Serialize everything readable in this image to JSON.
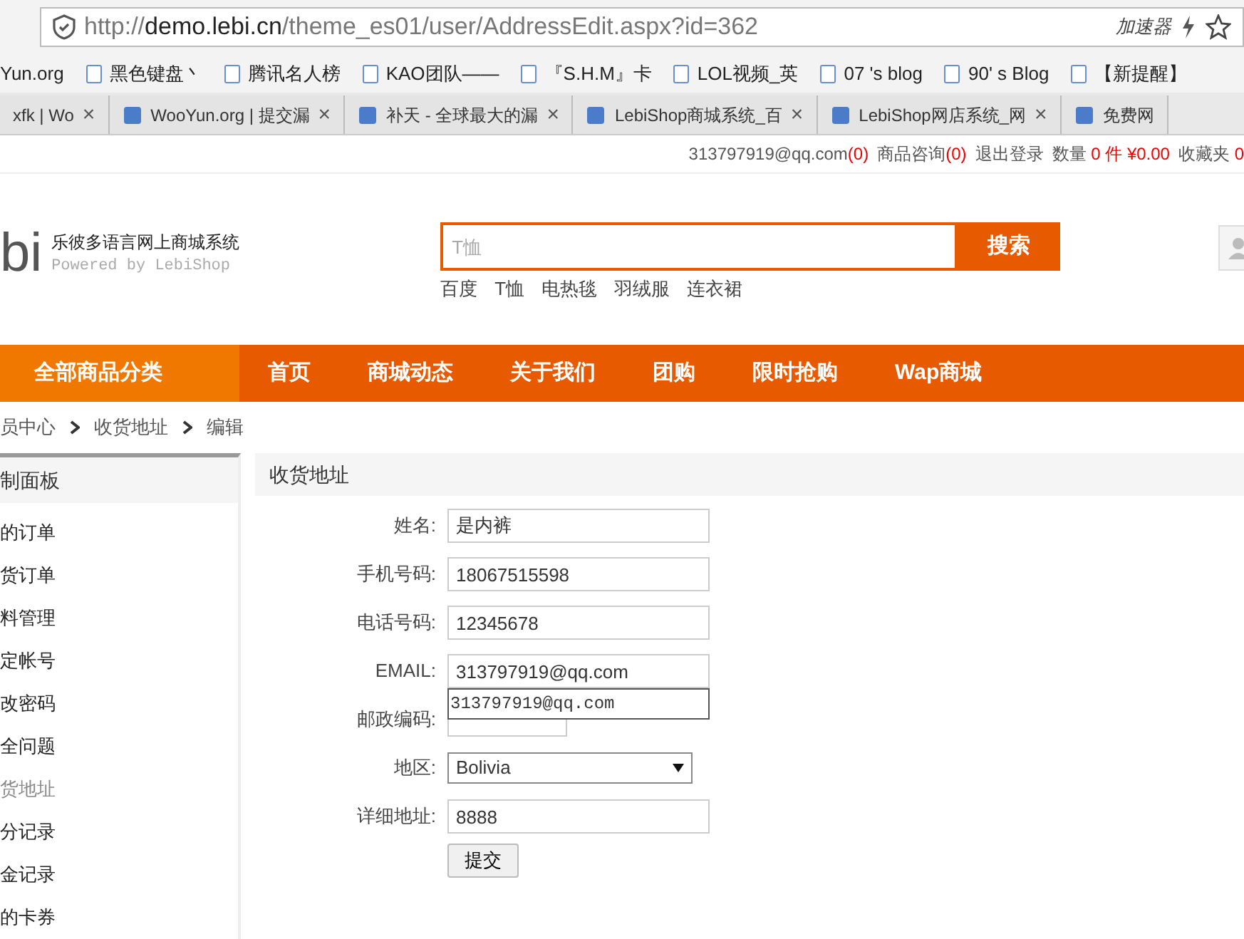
{
  "browser": {
    "url_prefix": "http://",
    "url_host": "demo.lebi.cn",
    "url_path": "/theme_es01/user/AddressEdit.aspx?id=362",
    "accelerator": "加速器",
    "bookmarks": [
      "Yun.org",
      "黑色键盘丶",
      "腾讯名人榜",
      "KAO团队——",
      "『S.H.M』卡",
      "LOL视频_英",
      "07 's blog",
      "90' s Blog",
      "【新提醒】"
    ],
    "tabs": [
      {
        "label": "xfk | Wo",
        "close": "×",
        "selected": false
      },
      {
        "label": "WooYun.org | 提交漏",
        "close": "×",
        "selected": false
      },
      {
        "label": "补天 - 全球最大的漏",
        "close": "×",
        "selected": false
      },
      {
        "label": "LebiShop商城系统_百",
        "close": "×",
        "selected": false
      },
      {
        "label": "LebiShop网店系统_网",
        "close": "×",
        "selected": false
      },
      {
        "label": "免费网",
        "selected": false
      }
    ]
  },
  "topbar": {
    "account": "313797919@qq.com",
    "account_count": "(0)",
    "consult": "商品咨询",
    "consult_count": "(0)",
    "logout": "退出登录",
    "qty_label": "数量",
    "qty": "0 件",
    "total": "¥0.00",
    "favorites": "收藏夹",
    "favorites_count": "0"
  },
  "header": {
    "logo": "bi",
    "title": "乐彼多语言网上商城系统",
    "powered": "Powered by LebiShop",
    "search": {
      "placeholder": "T恤"
    },
    "search_button": "搜索",
    "hot_words": [
      "百度",
      "T恤",
      "电热毯",
      "羽绒服",
      "连衣裙"
    ]
  },
  "nav": {
    "category": "全部商品分类",
    "items": [
      "首页",
      "商城动态",
      "关于我们",
      "团购",
      "限时抢购",
      "Wap商城"
    ]
  },
  "breadcrumb": [
    "员中心",
    "收货地址",
    "编辑"
  ],
  "sidebar": {
    "title": "制面板",
    "items": [
      {
        "label": "的订单",
        "selected": false
      },
      {
        "label": "货订单",
        "selected": false
      },
      {
        "label": "料管理",
        "selected": false
      },
      {
        "label": "定帐号",
        "selected": false
      },
      {
        "label": "改密码",
        "selected": false
      },
      {
        "label": "全问题",
        "selected": false
      },
      {
        "label": "货地址",
        "selected": true
      },
      {
        "label": "分记录",
        "selected": false
      },
      {
        "label": "金记录",
        "selected": false
      },
      {
        "label": "的卡券",
        "selected": false
      }
    ]
  },
  "form": {
    "title": "收货地址",
    "fields": [
      {
        "kind": "text",
        "label": "姓名:",
        "value": "是内裤"
      },
      {
        "kind": "text",
        "label": "手机号码:",
        "value": "18067515598"
      },
      {
        "kind": "text",
        "label": "电话号码:",
        "value": "12345678"
      },
      {
        "kind": "text",
        "label": "EMAIL:",
        "value": "313797919@qq.com",
        "suggestion": "313797919@qq.com"
      },
      {
        "kind": "short",
        "label": "邮政编码:"
      },
      {
        "kind": "select",
        "label": "地区:",
        "value": "Bolivia"
      },
      {
        "kind": "text",
        "label": "详细地址:",
        "value": "8888"
      }
    ],
    "submit": "提交"
  }
}
